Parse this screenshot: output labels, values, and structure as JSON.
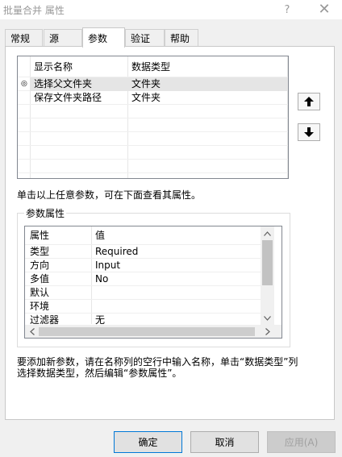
{
  "window": {
    "title": "批量合并 属性",
    "help_glyph": "?",
    "close_glyph": "✕"
  },
  "tabs": [
    {
      "label": "常规"
    },
    {
      "label": "源"
    },
    {
      "label": "参数"
    },
    {
      "label": "验证"
    },
    {
      "label": "帮助"
    }
  ],
  "active_tab": "参数",
  "params_grid": {
    "columns": [
      "显示名称",
      "数据类型"
    ],
    "rows": [
      {
        "name": "选择父文件夹",
        "type": "文件夹"
      },
      {
        "name": "保存文件夹路径",
        "type": "文件夹"
      }
    ],
    "current_row_marker": "◎"
  },
  "hint_select": "单击以上任意参数，可在下面查看其属性。",
  "param_props": {
    "title": "参数属性",
    "columns": [
      "属性",
      "值"
    ],
    "rows": [
      {
        "prop": "类型",
        "value": "Required"
      },
      {
        "prop": "方向",
        "value": "Input"
      },
      {
        "prop": "多值",
        "value": "No"
      },
      {
        "prop": "默认",
        "value": ""
      },
      {
        "prop": "环境",
        "value": ""
      },
      {
        "prop": "过滤器",
        "value": "无"
      }
    ]
  },
  "hint_add": "要添加新参数，请在名称列的空行中输入名称，单击“数据类型”列选择数据类型，然后编辑“参数属性”。",
  "buttons": {
    "ok": "确定",
    "cancel": "取消",
    "apply": "应用(A)"
  }
}
